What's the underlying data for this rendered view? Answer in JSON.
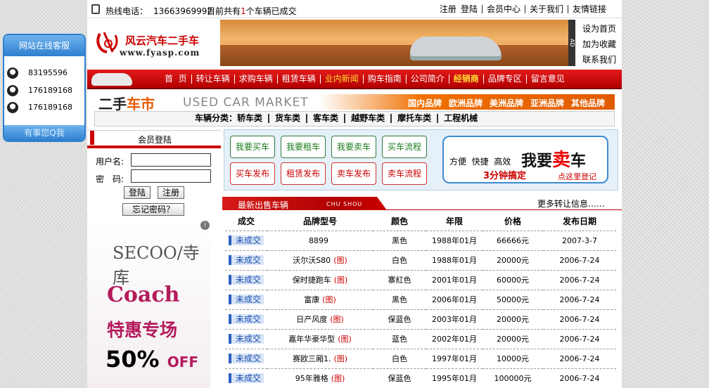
{
  "topbar": {
    "hotline_label": "热线电话：",
    "hotline_number": "13663969992",
    "deal_prefix": "目前共有",
    "deal_count": "1",
    "deal_suffix": "个车辆已成交",
    "links": [
      "注册",
      "登陆",
      "会员中心",
      "关于我们",
      "友情链接"
    ]
  },
  "header": {
    "logo_title": "风云汽车二手车",
    "logo_url": "www.fyasp.com",
    "banner_ad": "AD",
    "side_links": [
      "设为首页",
      "加为收藏",
      "联系我们"
    ]
  },
  "nav": {
    "items": [
      "首  页",
      "转让车辆",
      "求购车辆",
      "租赁车辆",
      "业内新闻",
      "购车指南",
      "公司简介",
      "经销商",
      "品牌专区",
      "留言意见"
    ]
  },
  "market": {
    "title_a": "二手",
    "title_b": "车市",
    "subtitle": "USED CAR MARKET",
    "brands": [
      "国内品牌",
      "欧洲品牌",
      "美洲品牌",
      "亚洲品牌",
      "其他品牌"
    ],
    "category_label": "车辆分类：",
    "categories": [
      "轿车类",
      "货车类",
      "客车类",
      "越野车类",
      "摩托车类",
      "工程机械"
    ]
  },
  "login": {
    "title": "会员登陆",
    "username_label": "用户名:",
    "password_label": "密　码:",
    "login_button": "登陆",
    "register_button": "注册",
    "forgot_button": "忘记密码？"
  },
  "ad": {
    "brand": "SECOO/寺库",
    "line1": "Coach",
    "line2": "特惠专场",
    "line3": "50%",
    "line4": "OFF",
    "info_icon": "i"
  },
  "actions": {
    "row1": [
      "我要买车",
      "我要租车",
      "我要卖车",
      "买车流程"
    ],
    "row2": [
      "买车发布",
      "租赁发布",
      "卖车发布",
      "卖车流程"
    ],
    "sell_box": {
      "tags": "方便  快捷  高效",
      "headline_a": "我要",
      "headline_b": "卖",
      "headline_c": "车",
      "slogan": "3分钟搞定",
      "link": "点这里登记"
    }
  },
  "listing": {
    "title": "最新出售车辆",
    "title_en": "CHU SHOU",
    "more": "更多转让信息……",
    "columns": [
      "成交",
      "品牌型号",
      "颜色",
      "年限",
      "价格",
      "发布日期"
    ],
    "rows": [
      {
        "status": "未成交",
        "model": "8899",
        "pic": "",
        "color": "黑色",
        "year": "1988年01月",
        "price": "66666元",
        "date": "2007-3-7"
      },
      {
        "status": "未成交",
        "model": "沃尔沃S80",
        "pic": "(图)",
        "color": "白色",
        "year": "1988年01月",
        "price": "20000元",
        "date": "2006-7-24"
      },
      {
        "status": "未成交",
        "model": "保时捷跑车",
        "pic": "(图)",
        "color": "寨紅色",
        "year": "2001年01月",
        "price": "60000元",
        "date": "2006-7-24"
      },
      {
        "status": "未成交",
        "model": "富康",
        "pic": "(图)",
        "color": "黑色",
        "year": "2006年01月",
        "price": "50000元",
        "date": "2006-7-24"
      },
      {
        "status": "未成交",
        "model": "日产风度",
        "pic": "(图)",
        "color": "保蓝色",
        "year": "2003年01月",
        "price": "20000元",
        "date": "2006-7-24"
      },
      {
        "status": "未成交",
        "model": "嘉年华豪华型",
        "pic": "(图)",
        "color": "蓝色",
        "year": "2002年01月",
        "price": "20000元",
        "date": "2006-7-24"
      },
      {
        "status": "未成交",
        "model": "赛欧三厢1.",
        "pic": "(图)",
        "color": "白色",
        "year": "1997年01月",
        "price": "10000元",
        "date": "2006-7-24"
      },
      {
        "status": "未成交",
        "model": "95年雅格",
        "pic": "(图)",
        "color": "保蓝色",
        "year": "1995年01月",
        "price": "100000元",
        "date": "2006-7-24"
      }
    ]
  },
  "service": {
    "title": "网站在线客服",
    "contacts": [
      "83195596",
      "176189168",
      "176189168"
    ],
    "footer": "有事您Q我"
  }
}
